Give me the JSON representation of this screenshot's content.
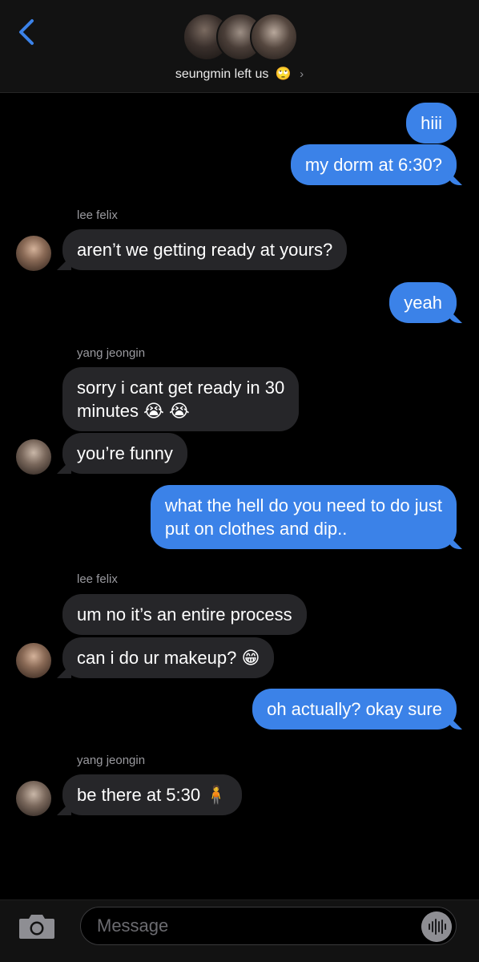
{
  "header": {
    "group_name": "seungmin left us",
    "emoji": "🙄",
    "chevron": "›"
  },
  "messages": [
    {
      "from": "me",
      "text": "hiii"
    },
    {
      "from": "me",
      "text": "my dorm at 6:30?"
    },
    {
      "sender": "lee felix"
    },
    {
      "from": "lee felix",
      "text": "aren’t we getting ready at yours?"
    },
    {
      "from": "me",
      "text": "yeah"
    },
    {
      "sender": "yang jeongin"
    },
    {
      "from": "yang jeongin",
      "line1": "sorry i cant get ready in 30",
      "line2": "minutes 😭 😭"
    },
    {
      "from": "yang jeongin",
      "text": "you’re funny"
    },
    {
      "from": "me",
      "line1": "what the hell do you need to do just",
      "line2": "put on clothes and dip.."
    },
    {
      "sender": "lee felix"
    },
    {
      "from": "lee felix",
      "text": "um no it’s an entire process"
    },
    {
      "from": "lee felix",
      "text": "can i do ur makeup? 😁"
    },
    {
      "from": "me",
      "text": "oh actually? okay sure"
    },
    {
      "sender": "yang jeongin"
    },
    {
      "from": "yang jeongin",
      "text": "be there at 5:30 🧍"
    }
  ],
  "input": {
    "placeholder": "Message"
  },
  "icons": {
    "back": "chevron-left-icon",
    "camera": "camera-icon",
    "audio": "audio-waveform-icon"
  },
  "colors": {
    "outgoing_bubble": "#3b82e8",
    "incoming_bubble": "#262629",
    "accent": "#3b82e8"
  }
}
